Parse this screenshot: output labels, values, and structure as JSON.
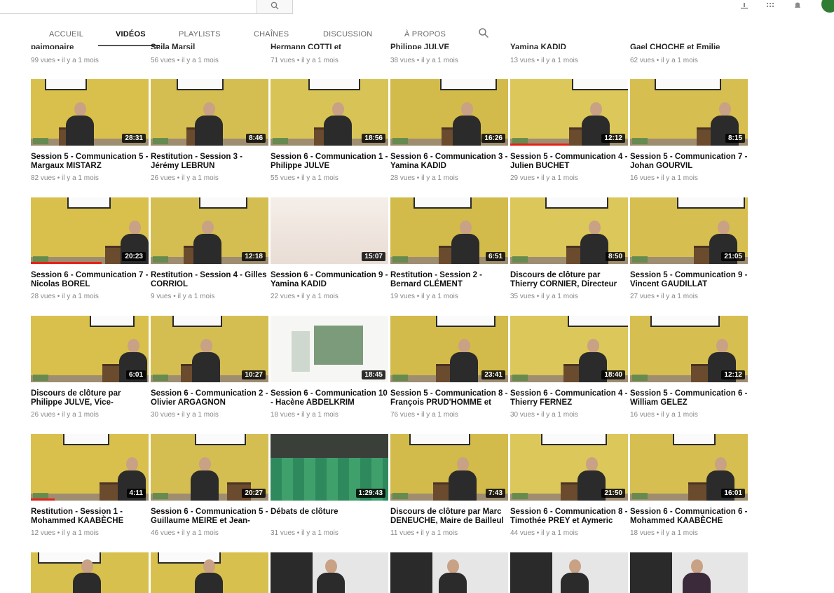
{
  "header": {
    "icons": [
      "upload-icon",
      "apps-icon",
      "notifications-icon"
    ],
    "search_icon": "search-icon"
  },
  "tabs": [
    {
      "label": "ACCUEIL",
      "active": false
    },
    {
      "label": "VIDÉOS",
      "active": true
    },
    {
      "label": "PLAYLISTS",
      "active": false
    },
    {
      "label": "CHAÎNES",
      "active": false
    },
    {
      "label": "DISCUSSION",
      "active": false
    },
    {
      "label": "À PROPOS",
      "active": false
    }
  ],
  "top_row": {
    "titles": [
      "paimonaire",
      "Seila Marsil",
      "Hermann COTTI et",
      "Philippe JULVE",
      "Yamina KADID",
      "Gael CHOCHE et Emilie"
    ],
    "meta": [
      "99 vues • il y a 1 mois",
      "56 vues • il y a 1 mois",
      "71 vues • il y a 1 mois",
      "38 vues • il y a 1 mois",
      "13 vues • il y a 1 mois",
      "62 vues • il y a 1 mois"
    ]
  },
  "videos": [
    {
      "title": "Session 5 - Communication 5 - Margaux MISTARZ",
      "duration": "28:31",
      "meta": "82 vues • il y a 1 mois",
      "progress": 0.0
    },
    {
      "title": "Restitution - Session 3 - Jérémy LEBRUN",
      "duration": "8:46",
      "meta": "26 vues • il y a 1 mois",
      "progress": 0.0
    },
    {
      "title": "Session 6 - Communication 1 - Philippe JULVE",
      "duration": "18:56",
      "meta": "55 vues • il y a 1 mois",
      "progress": 0.0
    },
    {
      "title": "Session 6 - Communication 3 - Yamina KADID",
      "duration": "16:26",
      "meta": "28 vues • il y a 1 mois",
      "progress": 0.0
    },
    {
      "title": "Session 5 - Communication 4 - Julien BUCHET",
      "duration": "12:12",
      "meta": "29 vues • il y a 1 mois",
      "progress": 0.5
    },
    {
      "title": "Session 5 - Communication 7 - Johan GOURVIL",
      "duration": "8:15",
      "meta": "16 vues • il y a 1 mois",
      "progress": 0.0
    },
    {
      "title": "Session 6 - Communication 7 - Nicolas BOREL",
      "duration": "20:23",
      "meta": "28 vues • il y a 1 mois",
      "progress": 0.6
    },
    {
      "title": "Restitution - Session 4 - Gilles CORRIOL",
      "duration": "12:18",
      "meta": "9 vues • il y a 1 mois",
      "progress": 0.0
    },
    {
      "title": "Session 6 - Communication 9 - Yamina KADID",
      "duration": "15:07",
      "meta": "22 vues • il y a 1 mois",
      "progress": 0.0
    },
    {
      "title": "Restitution - Session 2 - Bernard CLÉMENT",
      "duration": "6:51",
      "meta": "19 vues • il y a 1 mois",
      "progress": 0.0
    },
    {
      "title": "Discours de clôture par Thierry CORNIER, Directeur",
      "duration": "8:50",
      "meta": "35 vues • il y a 1 mois",
      "progress": 0.0
    },
    {
      "title": "Session 5 - Communication 9 - Vincent GAUDILLAT",
      "duration": "21:05",
      "meta": "27 vues • il y a 1 mois",
      "progress": 0.0
    },
    {
      "title": "Discours de clôture par Philippe JULVE, Vice-",
      "duration": "6:01",
      "meta": "26 vues • il y a 1 mois",
      "progress": 0.0
    },
    {
      "title": "Session 6 - Communication 2 - Olivier ARGAGNON",
      "duration": "10:27",
      "meta": "30 vues • il y a 1 mois",
      "progress": 0.0
    },
    {
      "title": "Session 6 - Communication 10 - Hacène ABDELKRIM",
      "duration": "18:45",
      "meta": "18 vues • il y a 1 mois",
      "progress": 0.0
    },
    {
      "title": "Session 5 - Communication 8 - François PRUD'HOMME et",
      "duration": "23:41",
      "meta": "76 vues • il y a 1 mois",
      "progress": 0.0
    },
    {
      "title": "Session 6 - Communication 4 - Thierry FERNEZ",
      "duration": "18:40",
      "meta": "30 vues • il y a 1 mois",
      "progress": 0.0
    },
    {
      "title": "Session 5 - Communication 6 - William GELEZ",
      "duration": "12:12",
      "meta": "16 vues • il y a 1 mois",
      "progress": 0.0
    },
    {
      "title": "Restitution - Session 1 - Mohammed KAABÈCHE",
      "duration": "4:11",
      "meta": "12 vues • il y a 1 mois",
      "progress": 0.2
    },
    {
      "title": "Session 6 - Communication 5 - Guillaume MEIRE et Jean-",
      "duration": "20:27",
      "meta": "46 vues • il y a 1 mois",
      "progress": 0.0
    },
    {
      "title": "Débats de clôture",
      "duration": "1:29:43",
      "meta": "31 vues • il y a 1 mois",
      "progress": 0.0
    },
    {
      "title": "Discours de clôture par Marc DENEUCHE, Maire de Bailleul",
      "duration": "7:43",
      "meta": "11 vues • il y a 1 mois",
      "progress": 0.0
    },
    {
      "title": "Session 6 - Communication 8 - Timothée PREY et Aymeric",
      "duration": "21:50",
      "meta": "44 vues • il y a 1 mois",
      "progress": 0.0
    },
    {
      "title": "Session 6 - Communication 6 - Mohammed KAABÈCHE",
      "duration": "16:01",
      "meta": "18 vues • il y a 1 mois",
      "progress": 0.0
    }
  ],
  "colors": {
    "accent": "#e62117",
    "wall": "#d8c24a",
    "text": "#111111",
    "meta": "#888888"
  }
}
